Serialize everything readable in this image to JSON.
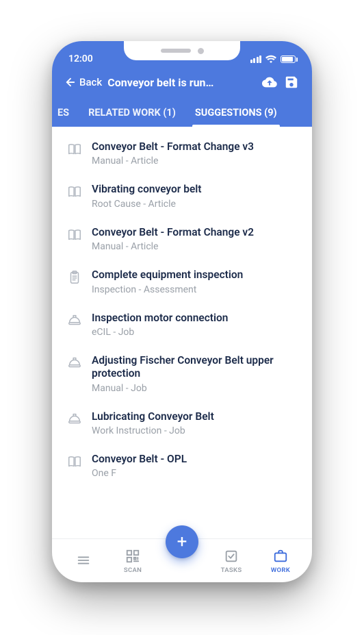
{
  "statusbar": {
    "time": "12:00"
  },
  "toolbar": {
    "back_label": "Back",
    "title": "Conveyor belt is run…"
  },
  "tabs": {
    "items": [
      {
        "label": "ES"
      },
      {
        "label": "RELATED WORK (1)"
      },
      {
        "label": "SUGGESTIONS (9)"
      }
    ],
    "active_index": 2
  },
  "suggestions": [
    {
      "icon": "book",
      "title": "Conveyor Belt - Format Change v3",
      "subtitle": "Manual - Article"
    },
    {
      "icon": "book",
      "title": "Vibrating conveyor belt",
      "subtitle": "Root Cause - Article"
    },
    {
      "icon": "book",
      "title": "Conveyor Belt - Format Change v2",
      "subtitle": "Manual - Article"
    },
    {
      "icon": "clipboard",
      "title": "Complete equipment inspection",
      "subtitle": "Inspection - Assessment"
    },
    {
      "icon": "helmet",
      "title": "Inspection motor connection",
      "subtitle": "eCIL - Job"
    },
    {
      "icon": "helmet",
      "title": "Adjusting Fischer Conveyor Belt upper protection",
      "subtitle": "Manual - Job"
    },
    {
      "icon": "helmet",
      "title": "Lubricating Conveyor Belt",
      "subtitle": "Work Instruction - Job"
    },
    {
      "icon": "book",
      "title": "Conveyor Belt - OPL",
      "subtitle": "One F"
    }
  ],
  "bottom_nav": {
    "items": [
      {
        "icon": "menu",
        "label": ""
      },
      {
        "icon": "scan",
        "label": "SCAN"
      },
      {
        "icon": "tasks",
        "label": "TASKS"
      },
      {
        "icon": "work",
        "label": "WORK"
      }
    ],
    "active_index": 3
  },
  "colors": {
    "primary": "#4d79de",
    "title_text": "#1c2b4a",
    "muted": "#9aa0a8"
  }
}
